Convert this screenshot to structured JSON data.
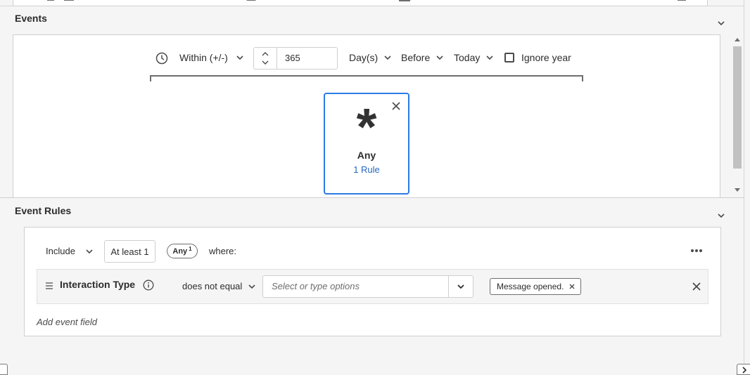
{
  "events_section": {
    "title": "Events",
    "within_label": "Within (+/-)",
    "count_value": "365",
    "unit_label": "Day(s)",
    "direction_label": "Before",
    "anchor_label": "Today",
    "ignore_year_label": "Ignore year",
    "card": {
      "symbol": "*",
      "title": "Any",
      "rule_link": "1 Rule"
    }
  },
  "event_rules_section": {
    "title": "Event Rules",
    "include_label": "Include",
    "at_least_label": "At least 1",
    "any_badge_label": "Any",
    "any_badge_count": "1",
    "where_label": "where:",
    "rule": {
      "field_name": "Interaction Type",
      "operator_label": "does not equal",
      "value_placeholder": "Select or type options",
      "selected_tag": "Message opened."
    },
    "add_event_field_label": "Add event field"
  },
  "colors": {
    "accent": "#2c7be5",
    "link": "#2567c2"
  }
}
